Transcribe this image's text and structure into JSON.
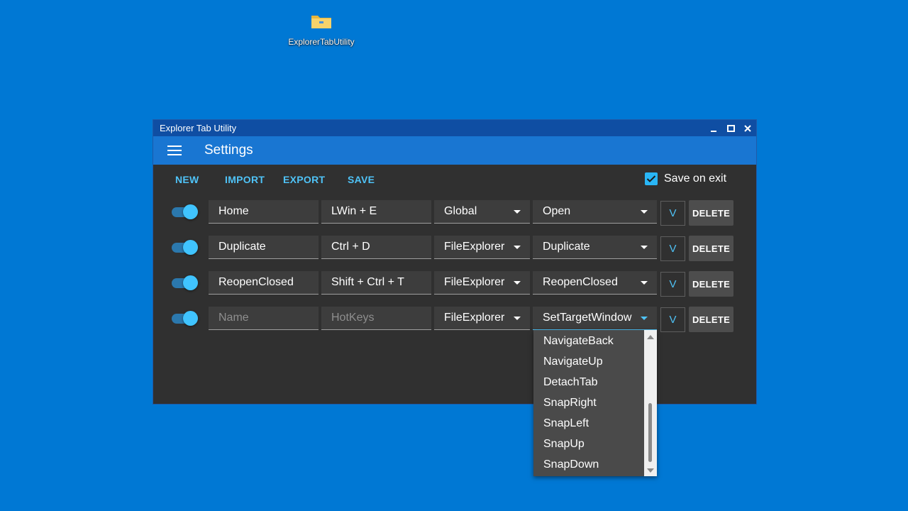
{
  "desktop": {
    "icon_label": "ExplorerTabUtility",
    "icon": "folder-icon"
  },
  "window": {
    "title": "Explorer Tab Utility",
    "controls": [
      "minimize-icon",
      "maximize-icon",
      "close-icon"
    ]
  },
  "appbar": {
    "menu_icon": "hamburger-menu-icon",
    "title": "Settings"
  },
  "toolbar": {
    "new": "NEW",
    "import": "IMPORT",
    "export": "EXPORT",
    "save": "SAVE",
    "save_on_exit_label": "Save on exit",
    "save_on_exit_checked": true
  },
  "accent": "#4fc3f7",
  "rows": [
    {
      "enabled": true,
      "name": "Home",
      "name_placeholder": "Name",
      "hotkeys": "LWin + E",
      "hotkeys_placeholder": "HotKeys",
      "scope": "Global",
      "action": "Open",
      "expand": "V",
      "delete": "DELETE"
    },
    {
      "enabled": true,
      "name": "Duplicate",
      "name_placeholder": "Name",
      "hotkeys": "Ctrl + D",
      "hotkeys_placeholder": "HotKeys",
      "scope": "FileExplorer",
      "action": "Duplicate",
      "expand": "V",
      "delete": "DELETE"
    },
    {
      "enabled": true,
      "name": "ReopenClosed",
      "name_placeholder": "Name",
      "hotkeys": "Shift + Ctrl + T",
      "hotkeys_placeholder": "HotKeys",
      "scope": "FileExplorer",
      "action": "ReopenClosed",
      "expand": "V",
      "delete": "DELETE"
    },
    {
      "enabled": true,
      "name": "",
      "name_placeholder": "Name",
      "hotkeys": "",
      "hotkeys_placeholder": "HotKeys",
      "scope": "FileExplorer",
      "action": "SetTargetWindow",
      "expand": "V",
      "delete": "DELETE"
    }
  ],
  "dropdown": {
    "options": [
      "NavigateBack",
      "NavigateUp",
      "DetachTab",
      "SnapRight",
      "SnapLeft",
      "SnapUp",
      "SnapDown"
    ]
  }
}
